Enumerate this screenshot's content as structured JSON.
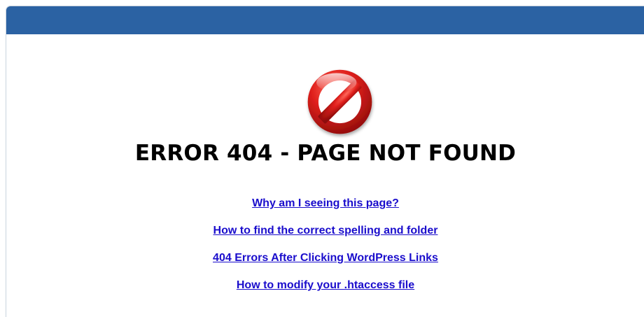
{
  "page": {
    "heading": "ERROR 404 - PAGE NOT FOUND",
    "icon": "prohibited-icon",
    "links": [
      {
        "label": "Why am I seeing this page?"
      },
      {
        "label": "How to find the correct spelling and folder"
      },
      {
        "label": "404 Errors After Clicking WordPress Links"
      },
      {
        "label": "How to modify your .htaccess file"
      }
    ]
  },
  "colors": {
    "header_bar": "#2b62a3",
    "link": "#1a0dcc",
    "icon_red": "#d6171a"
  }
}
